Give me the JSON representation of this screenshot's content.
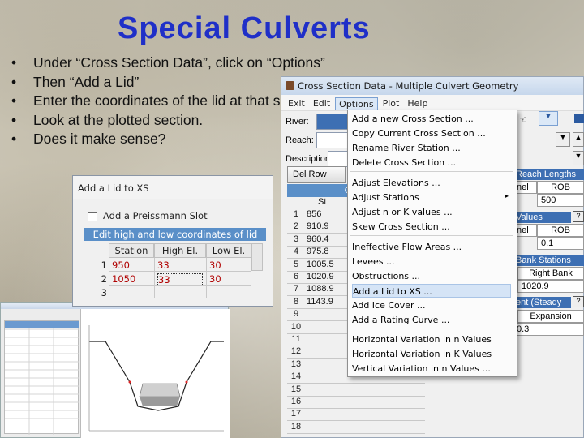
{
  "slide": {
    "title": "Special Culverts",
    "bullets": [
      "Under “Cross Section Data”, click on “Options”",
      "Then “Add a Lid”",
      "Enter the coordinates of the lid at that section",
      "Look at the plotted section.",
      "Does it make sense?"
    ]
  },
  "xs_window": {
    "title": "Cross Section Data - Multiple Culvert Geometry",
    "menu": [
      "Exit",
      "Edit",
      "Options",
      "Plot",
      "Help"
    ],
    "river_label": "River:",
    "reach_label": "Reach:",
    "description_label": "Description",
    "del_row_button": "Del Row",
    "grid_header": "Cross",
    "grid_subheader": "St",
    "row_numbers": [
      "1",
      "2",
      "3",
      "4",
      "5",
      "6",
      "7",
      "8",
      "9",
      "10",
      "11",
      "12",
      "13",
      "14",
      "15",
      "16",
      "17",
      "18"
    ],
    "station_values": [
      "856",
      "910.9",
      "960.4",
      "975.8",
      "1005.5",
      "1020.9",
      "1088.9",
      "1143.9"
    ],
    "panels": {
      "reach_lengths": "Reach Lengths",
      "reach_cols": [
        "nel",
        "ROB"
      ],
      "reach_val": "500",
      "n_values": "Values",
      "n_cols": [
        "nel",
        "ROB"
      ],
      "n_val": "0.1",
      "bank_stations": "Bank Stations",
      "right_bank": "Right Bank",
      "right_bank_val": "1020.9",
      "contraction": "ent (Steady",
      "expansion": "Expansion",
      "expansion_val": "0.3"
    }
  },
  "options_menu": {
    "items": [
      "Add a new Cross Section ...",
      "Copy Current Cross Section ...",
      "Rename River Station ...",
      "Delete Cross Section ...",
      "Adjust Elevations ...",
      "Adjust Stations",
      "Adjust n or K values ...",
      "Skew Cross Section ...",
      "Ineffective Flow Areas ...",
      "Levees ...",
      "Obstructions ...",
      "Add a Lid to XS ...",
      "Add Ice Cover ...",
      "Add a Rating Curve ...",
      "Horizontal Variation in n Values",
      "Horizontal Variation in K Values",
      "Vertical Variation in n Values ..."
    ]
  },
  "lid_window": {
    "title": "Add a Lid to XS",
    "preissmann_label": "Add a Preissmann Slot",
    "band": "Edit high and low coordinates of lid",
    "columns": [
      "Station",
      "High El.",
      "Low El."
    ],
    "rows": [
      {
        "n": "1",
        "station": "950",
        "high": "33",
        "low": "30"
      },
      {
        "n": "2",
        "station": "1050",
        "high": "33",
        "low": "30"
      },
      {
        "n": "3",
        "station": "",
        "high": "",
        "low": ""
      }
    ]
  },
  "colors": {
    "title": "#1f2fc8",
    "grid_header": "#5a8fc8",
    "menu_highlight": "#d5e4f6"
  }
}
